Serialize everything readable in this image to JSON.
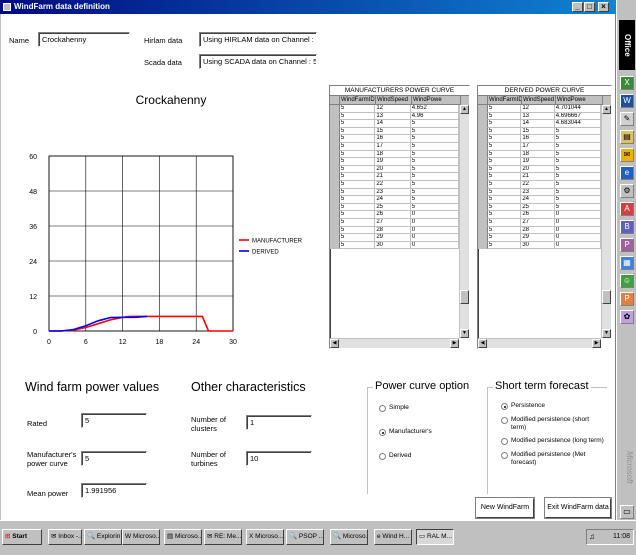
{
  "window": {
    "title": "WindFarm data definition",
    "min": "_",
    "max": "□",
    "close": "×"
  },
  "header": {
    "name_label": "Name",
    "name_value": "Crockahenny",
    "hirlam_label": "Hirlam data",
    "hirlam_value": "Using HIRLAM data on Channel : 5",
    "scada_label": "Scada data",
    "scada_value": "Using SCADA data on Channel : 5"
  },
  "chart_data": {
    "type": "line",
    "title": "Crockahenny",
    "xlim": [
      0,
      30
    ],
    "ylim": [
      0,
      60
    ],
    "x_ticks": [
      0,
      6,
      12,
      18,
      24,
      30
    ],
    "y_ticks": [
      0,
      12,
      24,
      36,
      48,
      60
    ],
    "grid": true,
    "legend": "right",
    "series": [
      {
        "name": "MANUFACTURER",
        "color": "#ff0000",
        "x": [
          0,
          2,
          4,
          6,
          8,
          10,
          12,
          13,
          14,
          16,
          18,
          20,
          24,
          25,
          26,
          30
        ],
        "y": [
          0,
          0,
          0.3,
          1.2,
          2.5,
          3.8,
          4.65,
          4.96,
          5,
          5,
          5,
          5,
          5,
          5,
          0,
          0
        ]
      },
      {
        "name": "DERIVED",
        "color": "#0000ff",
        "x": [
          0,
          2,
          4,
          6,
          8,
          10,
          12,
          13,
          14,
          16
        ],
        "y": [
          0,
          0,
          0.5,
          1.8,
          3.5,
          4.6,
          4.7,
          4.697,
          4.683,
          5
        ]
      }
    ]
  },
  "manufacturers": {
    "caption": "MANUFACTURERS POWER CURVE",
    "columns": [
      "WindFarmID",
      "WindSpeed",
      "WindPowe"
    ],
    "rows": [
      [
        "5",
        "12",
        "4.652"
      ],
      [
        "5",
        "13",
        "4.96"
      ],
      [
        "5",
        "14",
        "5"
      ],
      [
        "5",
        "15",
        "5"
      ],
      [
        "5",
        "16",
        "5"
      ],
      [
        "5",
        "17",
        "5"
      ],
      [
        "5",
        "18",
        "5"
      ],
      [
        "5",
        "19",
        "5"
      ],
      [
        "5",
        "20",
        "5"
      ],
      [
        "5",
        "21",
        "5"
      ],
      [
        "5",
        "22",
        "5"
      ],
      [
        "5",
        "23",
        "5"
      ],
      [
        "5",
        "24",
        "5"
      ],
      [
        "5",
        "25",
        "5"
      ],
      [
        "5",
        "26",
        "0"
      ],
      [
        "5",
        "27",
        "0"
      ],
      [
        "5",
        "28",
        "0"
      ],
      [
        "5",
        "29",
        "0"
      ],
      [
        "5",
        "30",
        "0"
      ]
    ]
  },
  "derived": {
    "caption": "DERIVED POWER CURVE",
    "columns": [
      "WindFarmID",
      "WindSpeed",
      "WindPowe"
    ],
    "rows": [
      [
        "5",
        "12",
        "4.701044"
      ],
      [
        "5",
        "13",
        "4.696667"
      ],
      [
        "5",
        "14",
        "4.683044"
      ],
      [
        "5",
        "15",
        "5"
      ],
      [
        "5",
        "16",
        "5"
      ],
      [
        "5",
        "17",
        "5"
      ],
      [
        "5",
        "18",
        "5"
      ],
      [
        "5",
        "19",
        "5"
      ],
      [
        "5",
        "20",
        "5"
      ],
      [
        "5",
        "21",
        "5"
      ],
      [
        "5",
        "22",
        "5"
      ],
      [
        "5",
        "23",
        "5"
      ],
      [
        "5",
        "24",
        "5"
      ],
      [
        "5",
        "25",
        "5"
      ],
      [
        "5",
        "26",
        "0"
      ],
      [
        "5",
        "27",
        "0"
      ],
      [
        "5",
        "28",
        "0"
      ],
      [
        "5",
        "29",
        "0"
      ],
      [
        "5",
        "30",
        "0"
      ]
    ]
  },
  "power_values": {
    "title": "Wind farm power values",
    "rated_label": "Rated",
    "rated_value": "5",
    "manu_label": "Manufacturer's power curve",
    "manu_value": "5",
    "mean_label": "Mean power",
    "mean_value": "1.991956"
  },
  "other": {
    "title": "Other characteristics",
    "clusters_label": "Number of clusters",
    "clusters_value": "1",
    "turbines_label": "Number of turbines",
    "turbines_value": "10"
  },
  "power_curve_option": {
    "title": "Power curve option",
    "options": [
      "Simple",
      "Manufacturer's",
      "Derived"
    ],
    "selected": 1
  },
  "short_term": {
    "title": "Short term forecast",
    "options": [
      "Persistence",
      "Modified persistence (short term)",
      "Modified persistence (long term)",
      "Modified persistence (Met forecast)"
    ],
    "selected": 0
  },
  "buttons": {
    "new": "New WindFarm",
    "exit": "Exit WindFarm data"
  },
  "officebar": {
    "label": "Office",
    "brand": "Microsoft"
  },
  "taskbar": {
    "start": "Start",
    "tasks": [
      "Inbox -...",
      "Explorin...",
      "Microso...",
      "Microso...",
      "RE: Me...",
      "Microso...",
      "PSOP ...",
      "Microso...",
      "Wind H...",
      "RAL M..."
    ],
    "clock": "11:08"
  }
}
